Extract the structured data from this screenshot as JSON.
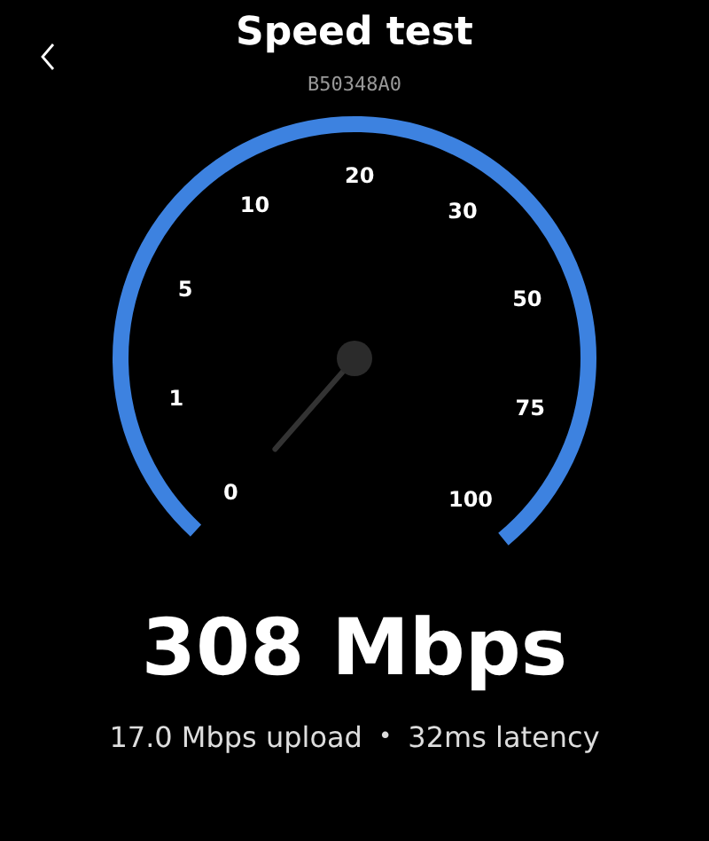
{
  "header": {
    "title": "Speed test",
    "serial": "B50348A0"
  },
  "gauge": {
    "scale_labels": [
      "0",
      "1",
      "5",
      "10",
      "20",
      "30",
      "50",
      "75",
      "100"
    ]
  },
  "result": {
    "speed": "308 Mbps",
    "upload": "17.0 Mbps upload",
    "separator": "•",
    "latency": "32ms latency"
  }
}
